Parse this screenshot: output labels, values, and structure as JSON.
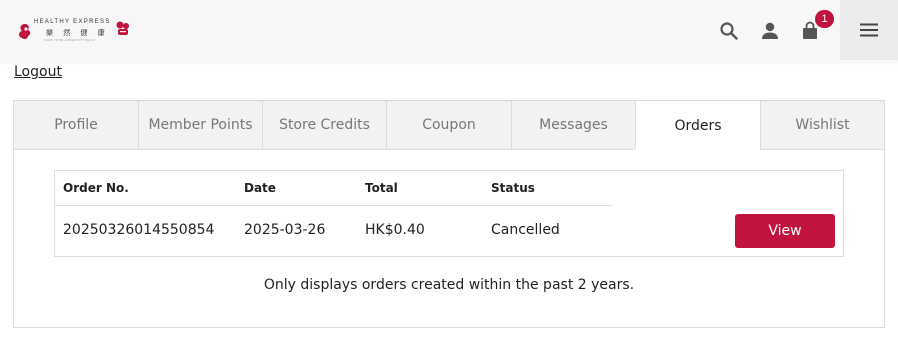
{
  "header": {
    "logo": {
      "name_en": "HEALTHY EXPRESS",
      "name_cn": "樂 然 健 康",
      "tagline": "TAKE YOUR LONGEVITY BACK"
    },
    "icons": [
      "search-icon",
      "user-icon",
      "cart-icon",
      "menu-icon"
    ],
    "cart_count": "1",
    "accent_color": "#c0133d"
  },
  "account": {
    "logout_label": "Logout"
  },
  "tabs": [
    {
      "label": "Profile"
    },
    {
      "label": "Member Points"
    },
    {
      "label": "Store Credits"
    },
    {
      "label": "Coupon"
    },
    {
      "label": "Messages"
    },
    {
      "label": "Orders",
      "active": true
    },
    {
      "label": "Wishlist"
    }
  ],
  "orders": {
    "columns": {
      "order_no": "Order No.",
      "date": "Date",
      "total": "Total",
      "status": "Status"
    },
    "rows": [
      {
        "order_no": "20250326014550854",
        "date": "2025-03-26",
        "total": "HK$0.40",
        "status": "Cancelled",
        "action_label": "View"
      }
    ],
    "note": "Only displays orders created within the past 2 years."
  }
}
